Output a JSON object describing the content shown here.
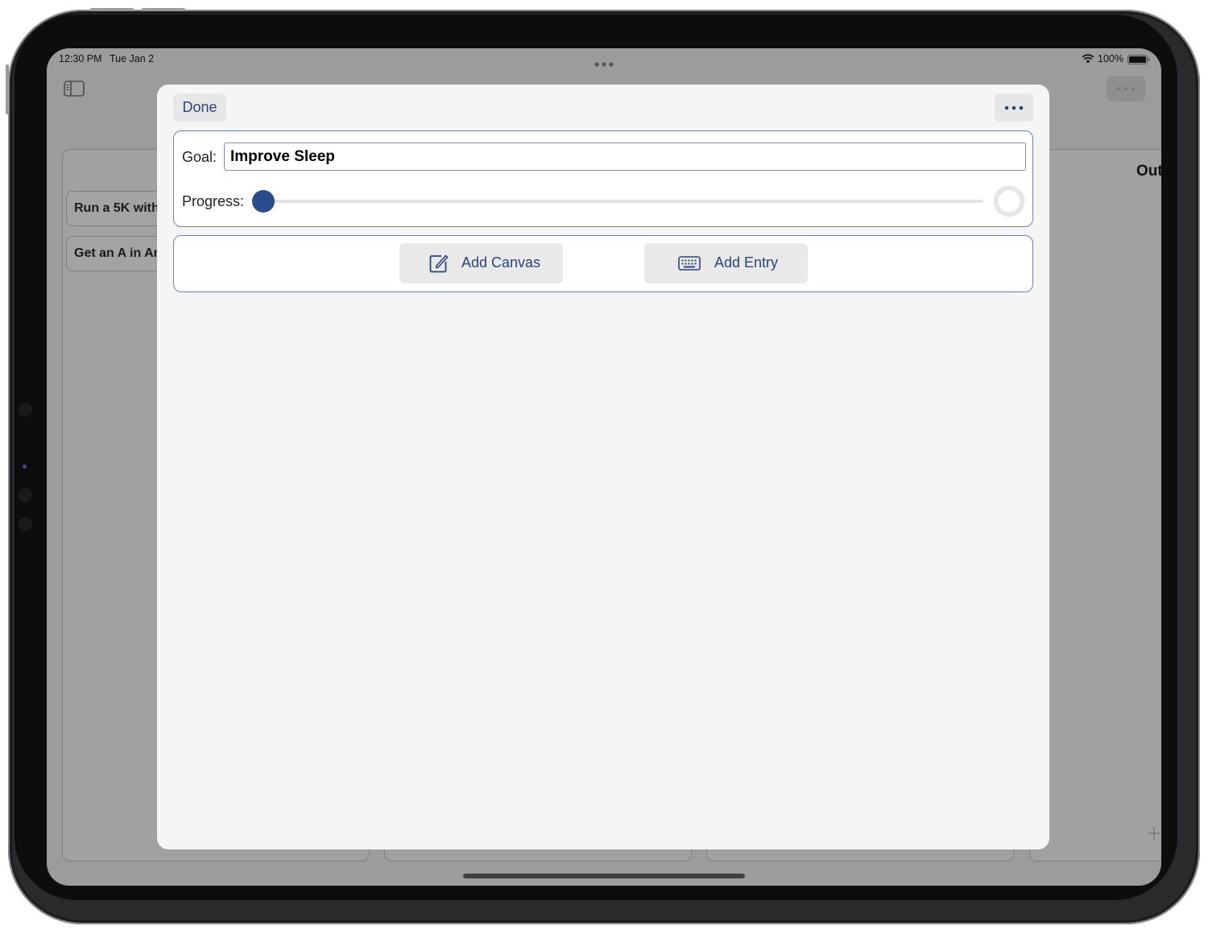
{
  "status_bar": {
    "time": "12:30 PM",
    "date": "Tue Jan 2",
    "battery": "100%"
  },
  "background_app": {
    "sidebar_icon": "sidebar-toggle-icon",
    "heading_partial": "Out",
    "cards": [
      "Run a 5K with",
      "Get an A in Ar"
    ],
    "add_icon": "plus-icon"
  },
  "sheet": {
    "done_label": "Done",
    "more_icon": "ellipsis-icon",
    "goal": {
      "label": "Goal:",
      "value": "Improve Sleep"
    },
    "progress": {
      "label": "Progress:",
      "value": 0,
      "completion_indicator": "empty-ring"
    },
    "actions": {
      "add_canvas": {
        "label": "Add Canvas",
        "icon": "compose-icon"
      },
      "add_entry": {
        "label": "Add Entry",
        "icon": "keyboard-icon"
      }
    }
  },
  "colors": {
    "accent": "#26447e",
    "slider_thumb": "#2a4c8c",
    "sheet_background": "#f5f5f5",
    "panel_border": "#6f82a4"
  }
}
